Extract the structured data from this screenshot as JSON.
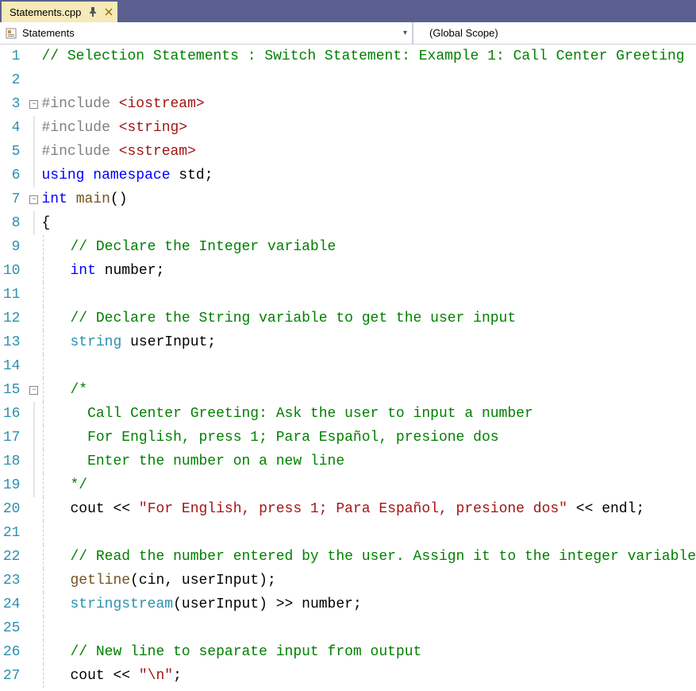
{
  "tab": {
    "filename": "Statements.cpp",
    "pin_title": "pin",
    "close_title": "×"
  },
  "navbar": {
    "left_label": "Statements",
    "right_label": "(Global Scope)"
  },
  "lines": [
    {
      "n": 1,
      "tokens": [
        [
          "c-comment",
          "// Selection Statements : Switch Statement: Example 1: Call Center Greeting"
        ]
      ],
      "indent": 0
    },
    {
      "n": 2,
      "tokens": [],
      "indent": 0
    },
    {
      "n": 3,
      "outline": "minus",
      "tokens": [
        [
          "c-include",
          "#include "
        ],
        [
          "c-angled",
          "<iostream>"
        ]
      ],
      "indent": 0
    },
    {
      "n": 4,
      "tokens": [
        [
          "c-include",
          "#include "
        ],
        [
          "c-angled",
          "<string>"
        ]
      ],
      "indent": 0,
      "vline": true
    },
    {
      "n": 5,
      "tokens": [
        [
          "c-include",
          "#include "
        ],
        [
          "c-angled",
          "<sstream>"
        ]
      ],
      "indent": 0,
      "vline": true
    },
    {
      "n": 6,
      "tokens": [
        [
          "c-keyword-blue",
          "using namespace "
        ],
        [
          "c-ident",
          "std;"
        ]
      ],
      "indent": 0,
      "vline": true
    },
    {
      "n": 7,
      "outline": "minus",
      "tokens": [
        [
          "c-keyword-blue",
          "int "
        ],
        [
          "c-func",
          "main"
        ],
        [
          "c-ident",
          "()"
        ]
      ],
      "indent": 0
    },
    {
      "n": 8,
      "tokens": [
        [
          "c-ident",
          "{"
        ]
      ],
      "indent": 0,
      "vline": true
    },
    {
      "n": 9,
      "tokens": [
        [
          "c-comment",
          "// Declare the Integer variable"
        ]
      ],
      "indent": 1,
      "guide0": true
    },
    {
      "n": 10,
      "tokens": [
        [
          "c-keyword-blue",
          "int "
        ],
        [
          "c-ident",
          "number;"
        ]
      ],
      "indent": 1,
      "guide0": true
    },
    {
      "n": 11,
      "tokens": [],
      "indent": 1,
      "guide0": true
    },
    {
      "n": 12,
      "tokens": [
        [
          "c-comment",
          "// Declare the String variable to get the user input"
        ]
      ],
      "indent": 1,
      "guide0": true
    },
    {
      "n": 13,
      "tokens": [
        [
          "c-type",
          "string "
        ],
        [
          "c-ident",
          "userInput;"
        ]
      ],
      "indent": 1,
      "guide0": true
    },
    {
      "n": 14,
      "tokens": [],
      "indent": 1,
      "guide0": true
    },
    {
      "n": 15,
      "outline": "minus",
      "tokens": [
        [
          "c-comment",
          "/*"
        ]
      ],
      "indent": 1,
      "guide0": true
    },
    {
      "n": 16,
      "tokens": [
        [
          "c-comment",
          "  Call Center Greeting: Ask the user to input a number"
        ]
      ],
      "indent": 1,
      "guide0": true,
      "vline": true
    },
    {
      "n": 17,
      "tokens": [
        [
          "c-comment",
          "  For English, press 1; Para Español, presione dos"
        ]
      ],
      "indent": 1,
      "guide0": true,
      "vline": true
    },
    {
      "n": 18,
      "tokens": [
        [
          "c-comment",
          "  Enter the number on a new line"
        ]
      ],
      "indent": 1,
      "guide0": true,
      "vline": true
    },
    {
      "n": 19,
      "tokens": [
        [
          "c-comment",
          "*/"
        ]
      ],
      "indent": 1,
      "guide0": true,
      "vline": true
    },
    {
      "n": 20,
      "tokens": [
        [
          "c-ident",
          "cout "
        ],
        [
          "c-op",
          "<< "
        ],
        [
          "c-string",
          "\"For English, press 1; Para Español, presione dos\""
        ],
        [
          "c-op",
          " << "
        ],
        [
          "c-ident",
          "endl;"
        ]
      ],
      "indent": 1,
      "guide0": true
    },
    {
      "n": 21,
      "tokens": [],
      "indent": 1,
      "guide0": true
    },
    {
      "n": 22,
      "tokens": [
        [
          "c-comment",
          "// Read the number entered by the user. Assign it to the integer variable"
        ]
      ],
      "indent": 1,
      "guide0": true
    },
    {
      "n": 23,
      "tokens": [
        [
          "c-func",
          "getline"
        ],
        [
          "c-ident",
          "("
        ],
        [
          "c-ident",
          "cin"
        ],
        [
          "c-ident",
          ", "
        ],
        [
          "c-ident",
          "userInput"
        ],
        [
          "c-ident",
          ");"
        ]
      ],
      "indent": 1,
      "guide0": true
    },
    {
      "n": 24,
      "tokens": [
        [
          "c-type",
          "stringstream"
        ],
        [
          "c-ident",
          "("
        ],
        [
          "c-ident",
          "userInput"
        ],
        [
          "c-ident",
          ") "
        ],
        [
          "c-op",
          ">> "
        ],
        [
          "c-ident",
          "number;"
        ]
      ],
      "indent": 1,
      "guide0": true
    },
    {
      "n": 25,
      "tokens": [],
      "indent": 1,
      "guide0": true
    },
    {
      "n": 26,
      "tokens": [
        [
          "c-comment",
          "// New line to separate input from output"
        ]
      ],
      "indent": 1,
      "guide0": true
    },
    {
      "n": 27,
      "tokens": [
        [
          "c-ident",
          "cout "
        ],
        [
          "c-op",
          "<< "
        ],
        [
          "c-string",
          "\"\\n\""
        ],
        [
          "c-ident",
          ";"
        ]
      ],
      "indent": 1,
      "guide0": true
    }
  ]
}
